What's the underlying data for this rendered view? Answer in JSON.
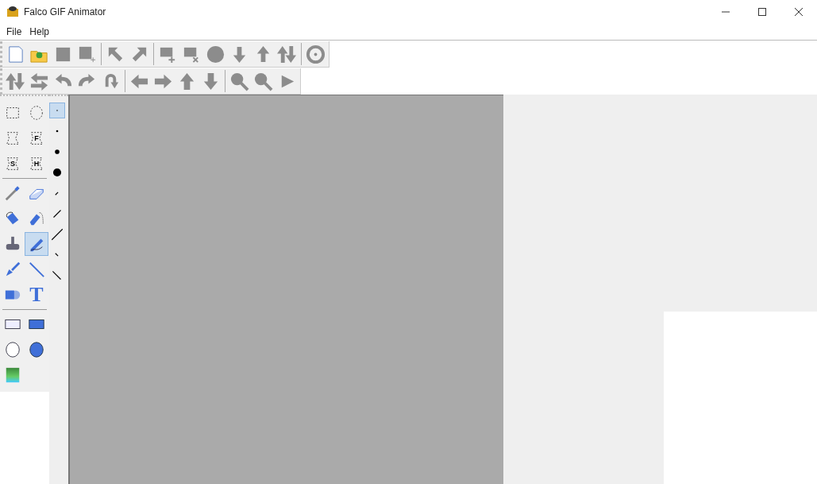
{
  "window": {
    "title": "Falco GIF Animator"
  },
  "menu": [
    {
      "label": "File"
    },
    {
      "label": "Help"
    }
  ],
  "tool_groups": [
    [
      {
        "selected": false
      },
      {
        "selected": false
      },
      {
        "selected": false
      },
      {
        "selected": false,
        "label": "F"
      },
      {
        "selected": false,
        "label": "S"
      },
      {
        "selected": false,
        "label": "H"
      }
    ],
    [
      {
        "selected": false
      },
      {
        "selected": false
      },
      {
        "selected": false
      },
      {
        "selected": false
      },
      {
        "selected": false
      },
      {
        "selected": true
      },
      {
        "selected": false
      },
      {
        "selected": false
      },
      {
        "selected": false
      },
      {
        "selected": false,
        "label": "T"
      }
    ],
    [
      {
        "selected": false
      },
      {
        "selected": false
      },
      {
        "selected": false
      },
      {
        "selected": false
      },
      {
        "selected": false
      }
    ]
  ],
  "brush_sizes": [
    {
      "selected": true
    },
    {
      "selected": false
    },
    {
      "selected": false
    },
    {
      "selected": false
    },
    {
      "selected": false
    },
    {
      "selected": false
    },
    {
      "selected": false
    },
    {
      "selected": false
    },
    {
      "selected": false
    }
  ]
}
